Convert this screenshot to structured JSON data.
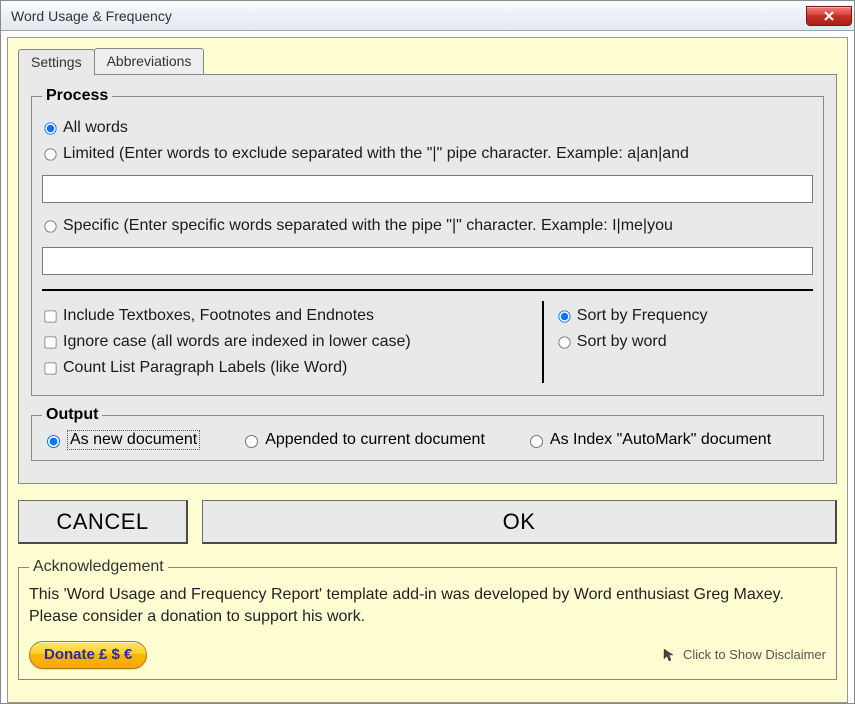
{
  "window": {
    "title": "Word Usage & Frequency"
  },
  "tabs": {
    "settings": "Settings",
    "abbreviations": "Abbreviations"
  },
  "process": {
    "legend": "Process",
    "allWords": "All words",
    "limited": "Limited (Enter words to exclude separated with the \"|\" pipe character.  Example: a|an|and",
    "limitedValue": "",
    "specific": "Specific (Enter specific words separated with the pipe \"|\" character.  Example: I|me|you",
    "specificValue": ""
  },
  "options": {
    "includeTextboxes": "Include Textboxes, Footnotes and Endnotes",
    "ignoreCase": "Ignore case (all words are indexed in lower case)",
    "countList": "Count List Paragraph Labels (like Word)",
    "sortByFreq": "Sort by Frequency",
    "sortByWord": "Sort by word"
  },
  "output": {
    "legend": "Output",
    "newDoc": "As new document",
    "appended": "Appended to current document",
    "autoMark": "As Index \"AutoMark\" document"
  },
  "buttons": {
    "cancel": "CANCEL",
    "ok": "OK"
  },
  "ack": {
    "legend": "Acknowledgement",
    "text": "This 'Word Usage and Frequency Report' template add-in was developed by Word enthusiast Greg Maxey.  Please consider a donation to support his work.",
    "donate": "Donate £ $ €",
    "disclaimer": "Click to Show Disclaimer"
  }
}
